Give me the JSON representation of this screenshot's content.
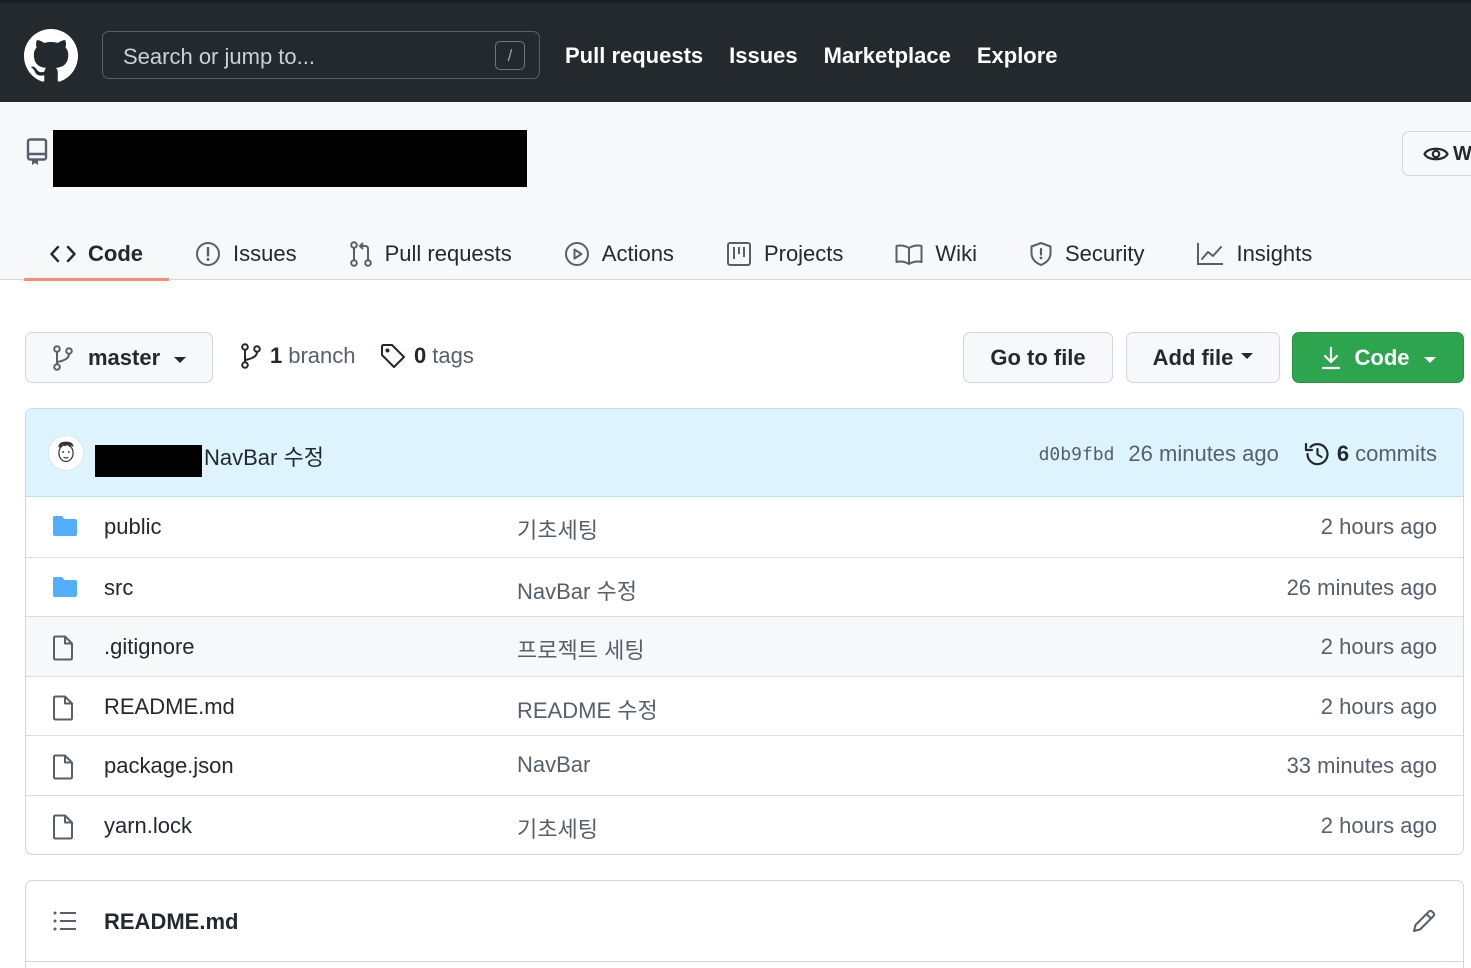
{
  "header": {
    "search_placeholder": "Search or jump to...",
    "search_shortcut": "/",
    "nav": [
      "Pull requests",
      "Issues",
      "Marketplace",
      "Explore"
    ]
  },
  "repo": {
    "watch_label": "W",
    "tabs": [
      {
        "label": "Code",
        "icon": "code-icon",
        "active": true
      },
      {
        "label": "Issues",
        "icon": "issue-opened-icon"
      },
      {
        "label": "Pull requests",
        "icon": "git-pull-request-icon"
      },
      {
        "label": "Actions",
        "icon": "play-icon"
      },
      {
        "label": "Projects",
        "icon": "project-icon"
      },
      {
        "label": "Wiki",
        "icon": "book-icon"
      },
      {
        "label": "Security",
        "icon": "shield-icon"
      },
      {
        "label": "Insights",
        "icon": "graph-icon"
      }
    ]
  },
  "branchbar": {
    "branch": "master",
    "branch_count": "1",
    "branch_word": "branch",
    "tag_count": "0",
    "tag_word": "tags",
    "go_to_file": "Go to file",
    "add_file": "Add file",
    "code": "Code"
  },
  "latest_commit": {
    "message": "NavBar 수정",
    "sha": "d0b9fbd",
    "time": "26 minutes ago",
    "commit_count": "6",
    "commit_word": "commits"
  },
  "files": [
    {
      "name": "public",
      "type": "folder",
      "message": "기초세팅",
      "age": "2 hours ago"
    },
    {
      "name": "src",
      "type": "folder",
      "message": "NavBar 수정",
      "age": "26 minutes ago"
    },
    {
      "name": ".gitignore",
      "type": "file",
      "message": "프로젝트 세팅",
      "age": "2 hours ago"
    },
    {
      "name": "README.md",
      "type": "file",
      "message": "README 수정",
      "age": "2 hours ago"
    },
    {
      "name": "package.json",
      "type": "file",
      "message": "NavBar",
      "age": "33 minutes ago"
    },
    {
      "name": "yarn.lock",
      "type": "file",
      "message": "기초세팅",
      "age": "2 hours ago"
    }
  ],
  "readme": {
    "title": "README.md"
  },
  "colors": {
    "header_bg": "#24292e",
    "accent_underline": "#fd8c73",
    "green_button": "#2da44e",
    "folder": "#54aeff",
    "commit_bar": "#ddf4ff"
  }
}
